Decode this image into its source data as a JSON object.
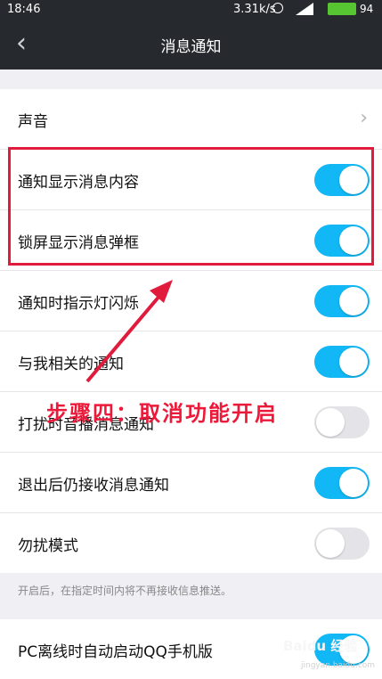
{
  "status_bar": {
    "time": "18:46",
    "network_speed": "3.31k/s",
    "battery": "94"
  },
  "nav": {
    "back_icon": "chevron-left",
    "title": "消息通知"
  },
  "section1": {
    "rows": [
      {
        "label": "声音",
        "type": "chevron"
      },
      {
        "label": "通知显示消息内容",
        "type": "toggle",
        "on": true
      },
      {
        "label": "锁屏显示消息弹框",
        "type": "toggle",
        "on": true
      },
      {
        "label": "通知时指示灯闪烁",
        "type": "toggle",
        "on": true
      },
      {
        "label": "与我相关的通知",
        "type": "toggle",
        "on": true
      },
      {
        "label": "打扰时音播消息通知",
        "type": "toggle",
        "on": false
      },
      {
        "label": "退出后仍接收消息通知",
        "type": "toggle",
        "on": true
      },
      {
        "label": "勿扰模式",
        "type": "toggle",
        "on": false
      }
    ]
  },
  "hint": "开启后，在指定时间内将不再接收信息推送。",
  "section2": {
    "rows": [
      {
        "label": "PC离线时自动启动QQ手机版",
        "type": "toggle",
        "on": true
      }
    ]
  },
  "annotation": "步骤四：取消功能开启",
  "watermark": {
    "brand": "Baidu 经验",
    "url": "jingyan.baidu.com"
  },
  "colors": {
    "accent": "#12b7f5",
    "nav_bg": "#262a2f",
    "highlight": "#e11b3c"
  }
}
